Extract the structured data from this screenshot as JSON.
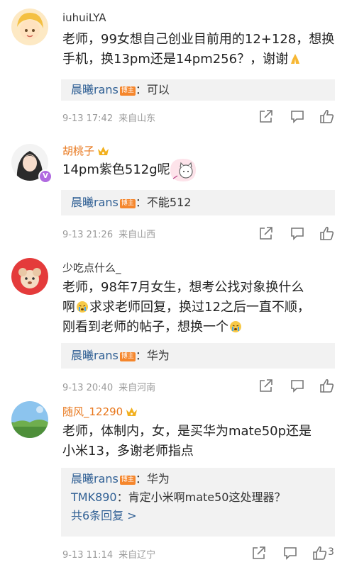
{
  "comments": [
    {
      "username": "iuhuiLYA",
      "text": "老师，99女想自己创业目前用的12+128，想换手机，换13pm还是14pm256？，谢谢",
      "reply": {
        "author": "晨曦rans",
        "badge": "博主",
        "text": "：可以"
      },
      "time": "9-13 17:42",
      "location": "来自山东"
    },
    {
      "username": "胡桃子",
      "text": "14pm紫色512g呢",
      "reply": {
        "author": "晨曦rans",
        "badge": "博主",
        "text": "：不能512"
      },
      "time": "9-13 21:26",
      "location": "来自山西"
    },
    {
      "username": "少吃点什么_",
      "text_lines": [
        "老师，98年7月女生，想考公找对象换什么",
        "啊",
        "求求老师回复，换过12之后一直不顺，",
        "刚看到老师的帖子，想换一个"
      ],
      "reply": {
        "author": "晨曦rans",
        "badge": "博主",
        "text": "：华为"
      },
      "time": "9-13 20:40",
      "location": "来自河南"
    },
    {
      "username": "随风_12290",
      "text_lines": [
        "老师，体制内，女，是买华为mate50p还是",
        "小米13，多谢老师指点"
      ],
      "reply": {
        "author": "晨曦rans",
        "badge": "博主",
        "text": "：华为"
      },
      "reply2": {
        "author": "TMK890",
        "text": "：肯定小米啊mate50这处理器？"
      },
      "more_replies": "共6条回复 >",
      "time": "9-13 11:14",
      "location": "来自辽宁",
      "like_count": "3"
    }
  ],
  "colors": {
    "link": "#2f5f94",
    "badge": "#f5862c",
    "vip_name": "#e8771c",
    "meta": "#9a9a9a",
    "reply_bg": "#f2f2f2"
  },
  "icons": [
    "share-icon",
    "comment-icon",
    "like-icon",
    "crown-icon",
    "pray-emoji",
    "cry-emoji"
  ]
}
